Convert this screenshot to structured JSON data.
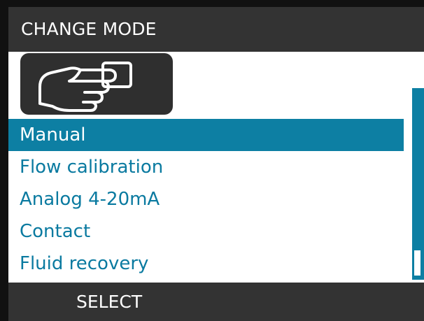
{
  "header": {
    "title": "CHANGE MODE"
  },
  "mode_icon": {
    "name": "hand-pressing-button-icon"
  },
  "menu": {
    "items": [
      {
        "label": "Manual",
        "selected": true
      },
      {
        "label": "Flow calibration",
        "selected": false
      },
      {
        "label": "Analog 4-20mA",
        "selected": false
      },
      {
        "label": "Contact",
        "selected": false
      },
      {
        "label": "Fluid recovery",
        "selected": false
      }
    ]
  },
  "footer": {
    "softkey_label": "SELECT"
  },
  "colors": {
    "accent": "#0d7fa3",
    "header_bg": "#333333",
    "frame": "#111111",
    "text_link": "#0a7aa0"
  }
}
